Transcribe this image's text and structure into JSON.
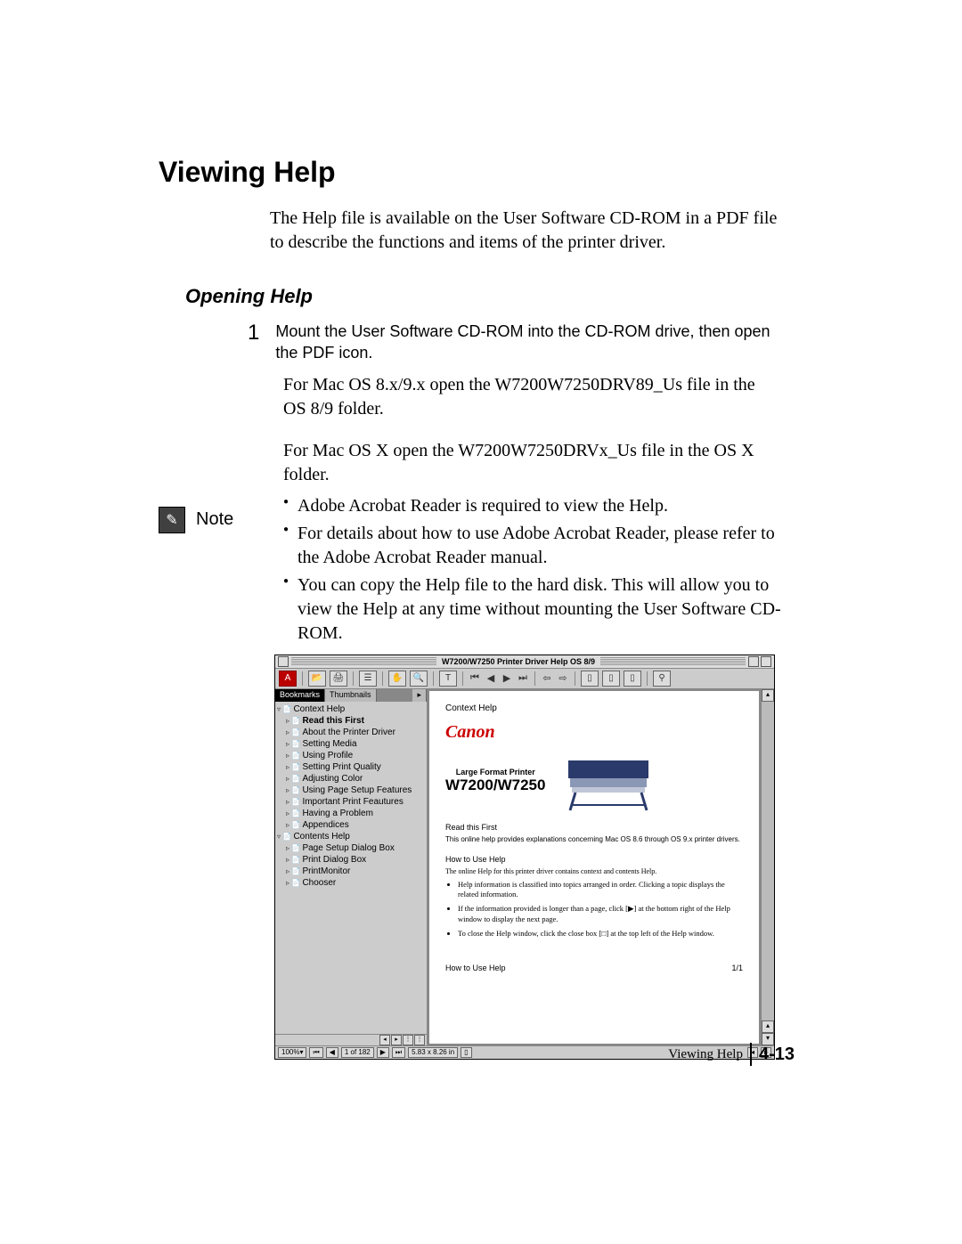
{
  "title": "Viewing Help",
  "intro": "The Help file is available on the User Software CD-ROM in a PDF file to describe the functions and items of the printer driver.",
  "sub": "Opening Help",
  "step_num": "1",
  "step_body": "Mount the User Software CD-ROM into the CD-ROM drive, then open the PDF icon.",
  "para1": "For Mac OS 8.x/9.x open the W7200W7250DRV89_Us file in the OS 8/9 folder.",
  "para2": "For Mac OS X open the W7200W7250DRVx_Us file in the OS X folder.",
  "note_label": "Note",
  "notes": [
    "Adobe Acrobat Reader is required to view the Help.",
    "For details about how to use Adobe Acrobat Reader, please refer to the Adobe Acrobat Reader manual.",
    "You can copy the Help file to the hard disk. This will allow you to view the Help at any time without mounting the User Software CD-ROM."
  ],
  "dlg": {
    "title": "W7200/W7250 Printer Driver Help OS 8/9",
    "tabs": {
      "active": "Bookmarks",
      "other": "Thumbnails"
    },
    "tree_context": "Context Help",
    "tree": [
      "Read this First",
      "About the Printer Driver",
      "Setting Media",
      "Using Profile",
      "Setting Print Quality",
      "Adjusting Color",
      "Using Page Setup Features",
      "Important Print Feautures",
      "Having a Problem",
      "Appendices"
    ],
    "tree_contents": "Contents Help",
    "tree2": [
      "Page Setup Dialog Box",
      "Print Dialog Box",
      "PrintMonitor",
      "Chooser"
    ],
    "content": {
      "context": "Context Help",
      "canon": "Canon",
      "lfp": "Large Format Printer",
      "model": "W7200/W7250",
      "read_first": "Read this First",
      "desc": "This online help provides explanations concerning Mac OS 8.6 through OS 9.x printer drivers.",
      "howto": "How to Use Help",
      "howto_intro": "The online Help for this printer driver contains context and contents Help.",
      "bullets": [
        "Help information is classified into topics arranged in order. Clicking a topic displays the related information.",
        "If the information provided is longer than a page, click [▶] at the bottom right of the Help window to display the next page.",
        "To close the Help window, click the close box [□] at the top left of the Help window."
      ],
      "foot_left": "How to Use Help",
      "foot_right": "1/1"
    },
    "status": {
      "zoom": "100%",
      "page": "1 of 182",
      "size": "5.83 x 8.26 in"
    }
  },
  "footer": {
    "label": "Viewing Help",
    "page": "4-13"
  }
}
